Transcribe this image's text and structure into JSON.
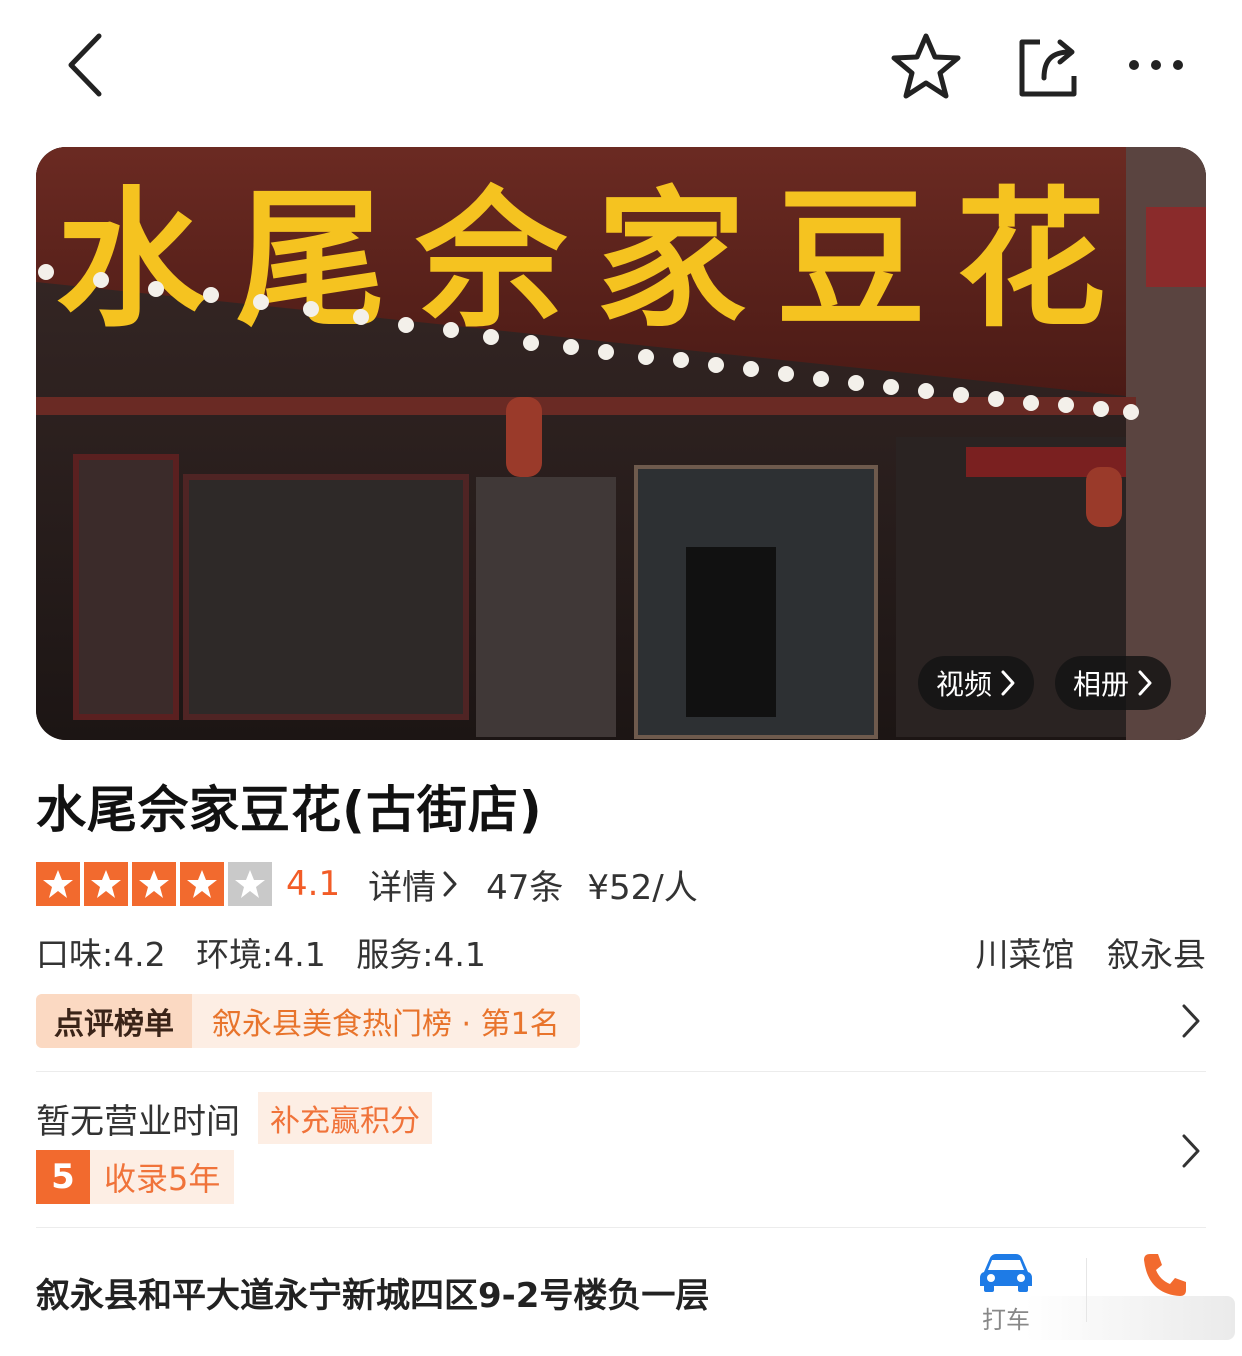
{
  "header": {
    "back_icon": "chevron-left-icon",
    "favorite_icon": "star-outline-icon",
    "share_icon": "share-icon",
    "more_icon": "more-dots-icon"
  },
  "hero": {
    "sign_text": "水尾佘家豆花",
    "video_label": "视频",
    "album_label": "相册"
  },
  "shop": {
    "name": "水尾佘家豆花(古街店)",
    "stars_filled": 4,
    "stars_total": 5,
    "score": "4.1",
    "detail_label": "详情",
    "review_count": "47条",
    "price": "¥52/人",
    "sub_scores": [
      "口味:4.2",
      "环境:4.1",
      "服务:4.1"
    ],
    "category": "川菜馆",
    "area": "叙永县"
  },
  "rank": {
    "tag": "点评榜单",
    "text": "叙永县美食热门榜 · 第1名"
  },
  "hours": {
    "text": "暂无营业时间",
    "points_label": "补充赢积分",
    "years_badge": "5",
    "years_text": "收录5年"
  },
  "address": {
    "text": "叙永县和平大道永宁新城四区9-2号楼负一层",
    "taxi_label": "打车",
    "taxi_icon": "car-icon",
    "phone_icon": "phone-icon"
  },
  "colors": {
    "accent": "#f25c27",
    "star_filled": "#f26a2e",
    "star_empty": "#c9c9c9",
    "taxi_blue": "#1e7be6"
  }
}
